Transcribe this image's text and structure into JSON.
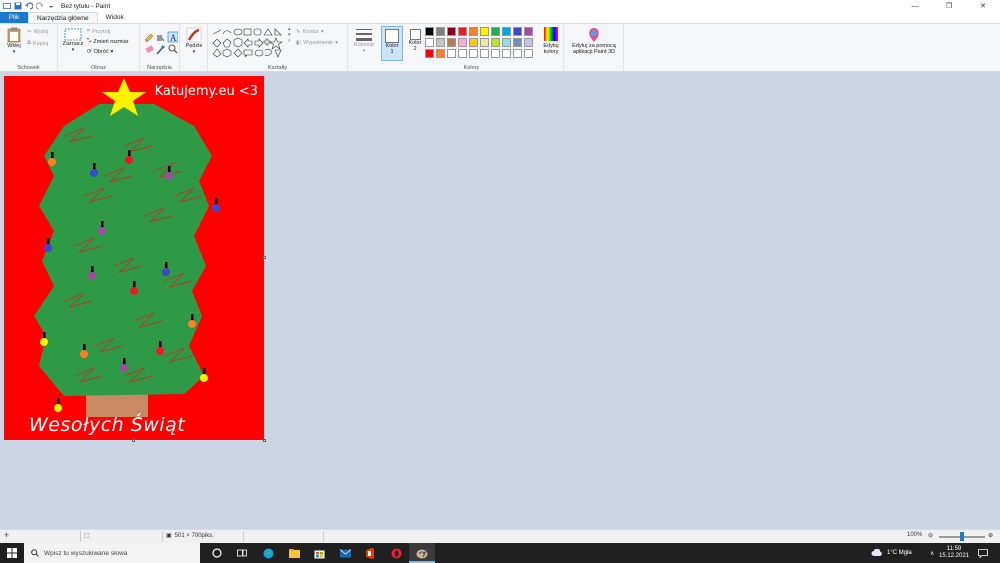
{
  "window": {
    "title": "Bez tytułu - Paint",
    "minimize_glyph": "—",
    "maximize_glyph": "❐",
    "close_glyph": "✕"
  },
  "tabs": [
    {
      "label": "Plik"
    },
    {
      "label": "Narzędzia główne"
    },
    {
      "label": "Widok"
    }
  ],
  "ribbon": {
    "clipboard": {
      "paste": "Wklej",
      "cut": "Wytnij",
      "copy": "Kopiuj",
      "group": "Schowek"
    },
    "image": {
      "select": "Zaznacz",
      "crop": "Przytnij",
      "resize": "Zmień rozmiar",
      "rotate": "Obróć",
      "group": "Obraz"
    },
    "tools": {
      "group": "Narzędzia"
    },
    "brushes": {
      "label": "Pędzle"
    },
    "shapes": {
      "outline": "Kontur",
      "fill": "Wypełnienie",
      "group": "Kształty"
    },
    "size": {
      "label": "Rozmiar"
    },
    "color1": {
      "label": "Kolor\n1"
    },
    "color2": {
      "label": "Kolor\n2"
    },
    "colors": {
      "group": "Kolory",
      "edit": "Edytuj\nkolory"
    },
    "paint3d": {
      "label": "Edytuj za pomocą\naplikacji Paint 3D"
    }
  },
  "palette": {
    "row1": [
      "#000000",
      "#7f7f7f",
      "#880015",
      "#ed1c24",
      "#ff7f27",
      "#fff200",
      "#22b14c",
      "#00a2e8",
      "#3f48cc",
      "#a349a4"
    ],
    "row2": [
      "#ffffff",
      "#c3c3c3",
      "#b97a57",
      "#ffaec9",
      "#ffc90e",
      "#efe4b0",
      "#b5e61d",
      "#99d9ea",
      "#7092be",
      "#c8bfe7"
    ],
    "row3": [
      "#ff0000",
      "#ff7f27",
      "#ffffff",
      "#ffffff",
      "#ffffff",
      "#ffffff",
      "#ffffff",
      "#ffffff",
      "#ffffff",
      "#ffffff"
    ],
    "color1": "#ffffff",
    "color2": "#ffffff"
  },
  "canvas": {
    "background": "#ff0000",
    "watermark": "Katujemy.eu <3",
    "greeting": "Wesołych Świąt",
    "tree_color": "#2e9a46",
    "pot_color": "#c98a63",
    "star_color": "#fff200"
  },
  "statusbar": {
    "image_size": "501 × 700piks.",
    "zoom": "100%"
  },
  "taskbar": {
    "search_placeholder": "Wpisz tu wyszukiwane słowa",
    "weather": "1°C  Mgła",
    "time": "11:59",
    "date": "15.12.2021"
  }
}
